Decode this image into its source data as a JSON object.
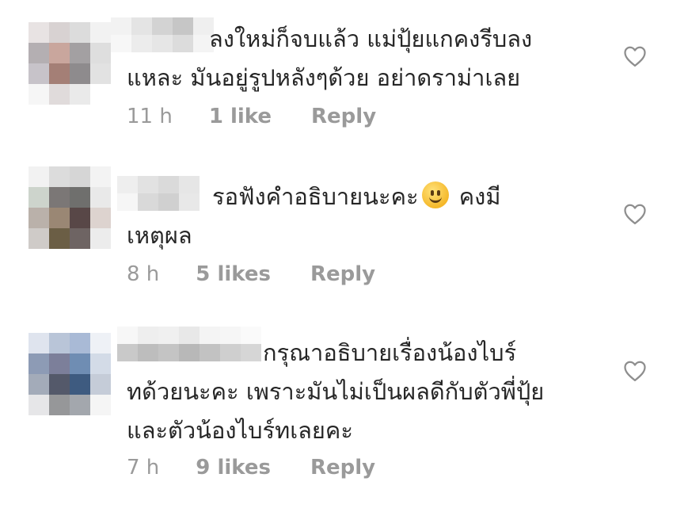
{
  "comments": [
    {
      "text_lines": [
        "ลงใหม่ก็จบแล้ว แม่ปุ้ยแกคงรีบลง",
        "แหละ มันอยู่รูปหลังๆด้วย อย่าดราม่าเลย"
      ],
      "time": "11 h",
      "likes": "1 like",
      "reply": "Reply"
    },
    {
      "text_lines": [
        "รอฟังคำอธิบายนะคะ",
        "คงมี",
        "เหตุผล"
      ],
      "time": "8 h",
      "likes": "5 likes",
      "reply": "Reply"
    },
    {
      "text_lines": [
        "กรุณาอธิบายเรื่องน้องไบร์",
        "ทด้วยนะคะ เพราะมันไม่เป็นผลดีกับตัวพี่ปุ้ย",
        "และตัวน้องไบร์ทเลยคะ"
      ],
      "time": "7 h",
      "likes": "9 likes",
      "reply": "Reply"
    }
  ],
  "icons": {
    "like": "heart-outline-icon",
    "emoji": "slightly-smiling-face-emoji"
  },
  "colors": {
    "text": "#262626",
    "meta": "#9a9a9a",
    "background": "#ffffff"
  }
}
